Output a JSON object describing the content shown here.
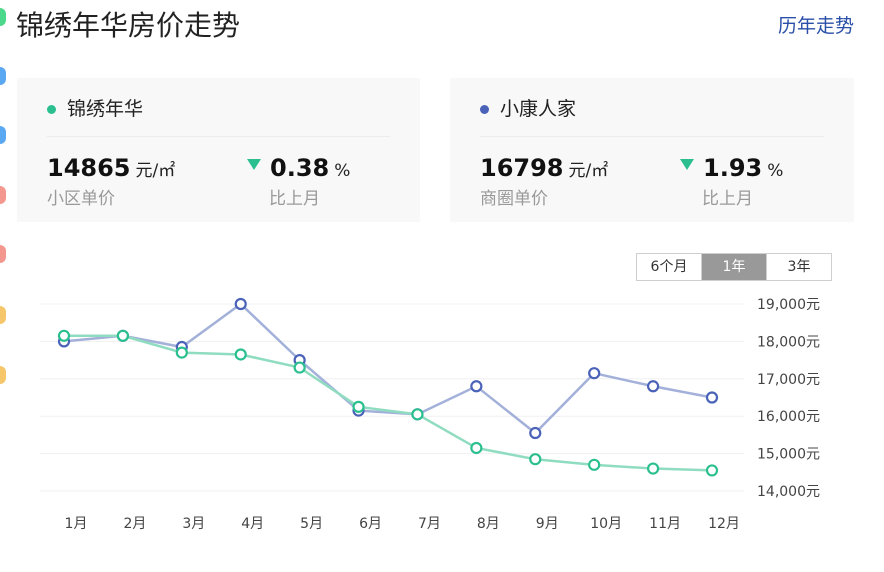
{
  "header": {
    "title": "锦绣年华房价走势",
    "history_link": "历年走势"
  },
  "cards": [
    {
      "name": "锦绣年华",
      "dot_color": "#2bbf8f",
      "price": "14865",
      "price_unit": "元/㎡",
      "price_label": "小区单价",
      "change": "0.38",
      "change_unit": "%",
      "change_label": "比上月"
    },
    {
      "name": "小康人家",
      "dot_color": "#4a62b8",
      "price": "16798",
      "price_unit": "元/㎡",
      "price_label": "商圈单价",
      "change": "1.93",
      "change_unit": "%",
      "change_label": "比上月"
    }
  ],
  "range_toggle": {
    "options": [
      "6个月",
      "1年",
      "3年"
    ],
    "selected": "1年"
  },
  "edge_tabs": [
    "#4cd88a",
    "#5aa7f2",
    "#5aa7f2",
    "#f4978e",
    "#f4978e",
    "#f6c76a",
    "#f6c76a"
  ],
  "chart_data": {
    "type": "line",
    "categories": [
      "1月",
      "2月",
      "3月",
      "4月",
      "5月",
      "6月",
      "7月",
      "8月",
      "9月",
      "10月",
      "11月",
      "12月"
    ],
    "series": [
      {
        "name": "锦绣年华",
        "color": "#2bbf8f",
        "values": [
          18150,
          18150,
          17700,
          17650,
          17300,
          16250,
          16050,
          15150,
          14850,
          14700,
          14600,
          14550
        ]
      },
      {
        "name": "小康人家",
        "color": "#4a62b8",
        "values": [
          18000,
          18150,
          17850,
          19000,
          17500,
          16150,
          16050,
          16800,
          15550,
          17150,
          16800,
          16500
        ]
      }
    ],
    "y_ticks": [
      "19,000元",
      "18,000元",
      "17,000元",
      "16,000元",
      "15,000元",
      "14,000元"
    ],
    "y_tick_values": [
      19000,
      18000,
      17000,
      16000,
      15000,
      14000
    ],
    "ylim": [
      14000,
      19000
    ],
    "grid": true
  }
}
